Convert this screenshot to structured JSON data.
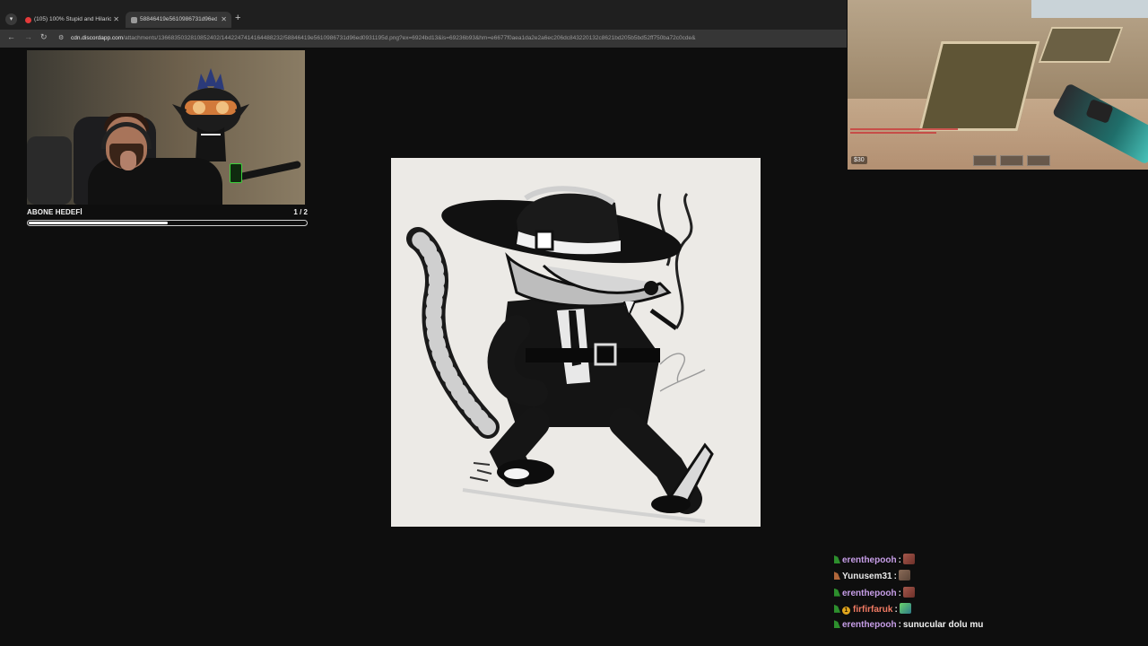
{
  "browser": {
    "tabs": [
      {
        "label": "(105) 100% Stupid and Hilariou",
        "active": false
      },
      {
        "label": "58846419e5610986731d96ed0",
        "active": true
      }
    ],
    "address": {
      "host": "cdn.discordapp.com",
      "path": "/attachments/1366835032810852402/1442247414164488232/58846419e5610986731d96ed0931195d.png?ex=6924bd13&is=69236b93&hm=e6677f0aea1da2e2a6ec206dc843220132c8621bd205b5bd52ff750ba72c0cde&"
    }
  },
  "stream_overlay": {
    "goal_label": "ABONE HEDEFİ",
    "goal_count": "1 / 2",
    "goal_progress": 0.5
  },
  "game_hud": {
    "money": "$30"
  },
  "chat": {
    "messages": [
      {
        "user": "erenthepooh",
        "user_color": "#c79ee8",
        "badge": "badge-green",
        "emote": "emote-red",
        "text": ""
      },
      {
        "user": "Yunusem31",
        "user_color": "#e8e8e8",
        "badge": "badge-orange",
        "emote": "emote-brown",
        "text": ""
      },
      {
        "user": "erenthepooh",
        "user_color": "#c79ee8",
        "badge": "badge-green",
        "emote": "emote-red",
        "text": ""
      },
      {
        "user": "firfirfaruk",
        "user_color": "#f07a63",
        "badge": "badge-green-gold",
        "emote": "emote-green",
        "text": ""
      },
      {
        "user": "erenthepooh",
        "user_color": "#c79ee8",
        "badge": "badge-green",
        "emote": "",
        "text": "sunucular dolu mu"
      }
    ]
  },
  "icons": {
    "tab_menu": "chevron-down-icon",
    "new_tab": "plus-icon",
    "back": "arrow-left-icon",
    "forward": "arrow-right-icon",
    "reload": "reload-icon",
    "site_info": "site-info-icon"
  }
}
